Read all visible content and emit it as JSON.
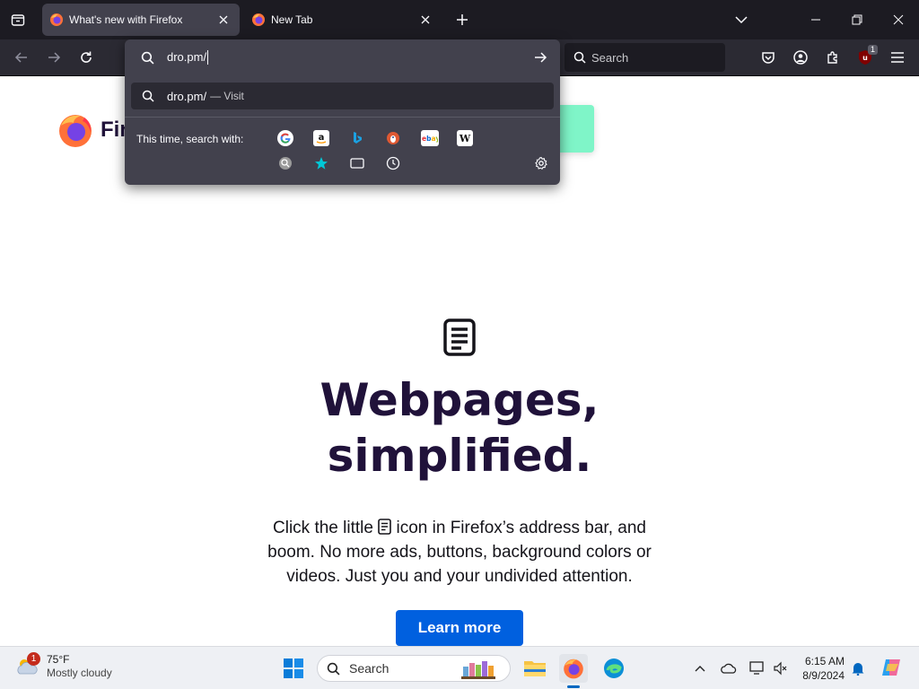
{
  "tabs": [
    {
      "title": "What's new with Firefox",
      "active": true
    },
    {
      "title": "New Tab",
      "active": false
    }
  ],
  "navbar": {
    "search_placeholder": "Search",
    "extension_badge": "1"
  },
  "urlbar": {
    "value": "dro.pm/",
    "suggestion_text": "dro.pm/",
    "suggestion_action": "— Visit",
    "search_with_label": "This time, search with:",
    "engines": [
      "google",
      "amazon",
      "bing",
      "duckduckgo",
      "ebay",
      "wikipedia",
      "search-engine",
      "bookmarks",
      "tabs",
      "history"
    ]
  },
  "page": {
    "logo_text": "Firef",
    "headline_line1": "Webpages,",
    "headline_line2": "simplified.",
    "body_part1": "Click the little",
    "body_part2": "icon in Firefox’s address bar, and boom. No more ads, buttons, background colors or videos. Just you and your undivided attention.",
    "learn_more": "Learn more"
  },
  "taskbar": {
    "weather_temp": "75°F",
    "weather_desc": "Mostly cloudy",
    "weather_badge": "1",
    "search_label": "Search",
    "time": "6:15 AM",
    "date": "8/9/2024"
  },
  "colors": {
    "accent": "#0060df",
    "headline": "#20123a",
    "chrome_dark": "#1c1b22",
    "toolbar": "#2b2a33",
    "popup": "#42414d"
  }
}
